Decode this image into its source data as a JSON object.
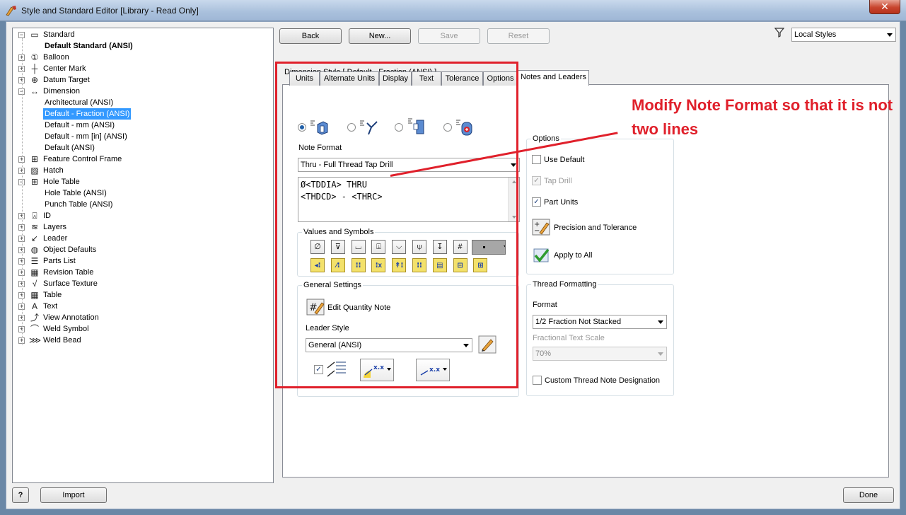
{
  "window": {
    "title": "Style and Standard Editor [Library - Read Only]",
    "close_glyph": "✕"
  },
  "tree": {
    "items": [
      {
        "label": "Standard",
        "icon": "standard-icon",
        "glyph": "▭",
        "expanded": true
      },
      {
        "label": "Default Standard (ANSI)",
        "bold": true
      },
      {
        "label": "Balloon",
        "icon": "balloon-icon",
        "glyph": "①"
      },
      {
        "label": "Center Mark",
        "icon": "center-mark-icon",
        "glyph": "┼"
      },
      {
        "label": "Datum Target",
        "icon": "datum-target-icon",
        "glyph": "⊕"
      },
      {
        "label": "Dimension",
        "icon": "dimension-icon",
        "glyph": "↔",
        "expanded": true
      },
      {
        "label": "Architectural (ANSI)"
      },
      {
        "label": "Default - Fraction (ANSI)",
        "selected": true
      },
      {
        "label": "Default - mm (ANSI)"
      },
      {
        "label": "Default - mm [in] (ANSI)"
      },
      {
        "label": "Default (ANSI)"
      },
      {
        "label": "Feature Control Frame",
        "icon": "feature-control-frame-icon",
        "glyph": "⊞"
      },
      {
        "label": "Hatch",
        "icon": "hatch-icon",
        "glyph": "▨"
      },
      {
        "label": "Hole Table",
        "icon": "hole-table-icon",
        "glyph": "⊞",
        "expanded": true
      },
      {
        "label": "Hole Table (ANSI)"
      },
      {
        "label": "Punch Table (ANSI)"
      },
      {
        "label": "ID",
        "icon": "id-icon",
        "glyph": "⍓"
      },
      {
        "label": "Layers",
        "icon": "layers-icon",
        "glyph": "≋"
      },
      {
        "label": "Leader",
        "icon": "leader-icon",
        "glyph": "↙"
      },
      {
        "label": "Object Defaults",
        "icon": "object-defaults-icon",
        "glyph": "◍"
      },
      {
        "label": "Parts List",
        "icon": "parts-list-icon",
        "glyph": "☰"
      },
      {
        "label": "Revision Table",
        "icon": "revision-table-icon",
        "glyph": "▦"
      },
      {
        "label": "Surface Texture",
        "icon": "surface-texture-icon",
        "glyph": "√"
      },
      {
        "label": "Table",
        "icon": "table-icon",
        "glyph": "▦"
      },
      {
        "label": "Text",
        "icon": "text-icon",
        "glyph": "A"
      },
      {
        "label": "View Annotation",
        "icon": "view-annotation-icon",
        "glyph": "⤴"
      },
      {
        "label": "Weld Symbol",
        "icon": "weld-symbol-icon",
        "glyph": "⌒"
      },
      {
        "label": "Weld Bead",
        "icon": "weld-bead-icon",
        "glyph": "⋙"
      }
    ]
  },
  "toolbar": {
    "back": "Back",
    "new": "New...",
    "save": "Save",
    "reset": "Reset",
    "filter_value": "Local Styles"
  },
  "main": {
    "style_heading": "Dimension Style [ Default - Fraction (ANSI) ]",
    "tabs": [
      "Units",
      "Alternate Units",
      "Display",
      "Text",
      "Tolerance",
      "Options",
      "Notes and Leaders"
    ],
    "note_format_label": "Note Format",
    "note_format_value": "Thru - Full Thread Tap Drill",
    "note_text_line1": "Ø<TDDIA> THRU",
    "note_text_line2": "<THDCD> - <THRC>",
    "values_symbols_title": "Values and Symbols",
    "symbols_row1": [
      "∅",
      "⊽",
      "⌴",
      "⍗",
      "⌵",
      "⍦",
      "↧",
      "#"
    ],
    "symbols_row2": [
      "◂⁝",
      "⁄⁝",
      "⁝⁝",
      "⁝x",
      "↟⁝",
      "⁝⁝",
      "▤",
      "⊟",
      "⊞"
    ],
    "general_settings_title": "General Settings",
    "edit_quantity_note": "Edit Quantity Note",
    "leader_style_label": "Leader Style",
    "leader_style_value": "General (ANSI)",
    "xx_label": "x.x",
    "options_title": "Options",
    "use_default": "Use Default",
    "tap_drill": "Tap Drill",
    "part_units": "Part Units",
    "precision_tolerance": "Precision and Tolerance",
    "apply_to_all": "Apply to All",
    "thread_formatting_title": "Thread Formatting",
    "format_label": "Format",
    "format_value": "1/2 Fraction Not Stacked",
    "fractional_scale_label": "Fractional Text Scale",
    "fractional_scale_value": "70%",
    "custom_thread": "Custom Thread Note Designation",
    "checks": {
      "use_default": false,
      "tap_drill": true,
      "part_units": true,
      "custom_thread": false,
      "leader_toggle": true
    }
  },
  "footer": {
    "help": "?",
    "import": "Import",
    "done": "Done"
  },
  "annotation": {
    "text": "Modify Note Format so that it is not two lines",
    "color": "#e0202b"
  }
}
